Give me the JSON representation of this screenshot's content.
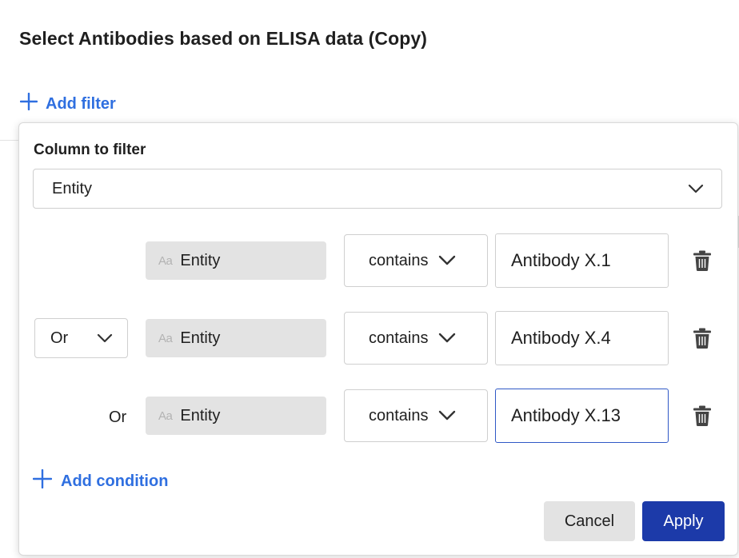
{
  "page": {
    "title": "Select Antibodies based on ELISA data (Copy)"
  },
  "toolbar": {
    "add_filter_label": "Add filter"
  },
  "filter_popover": {
    "column_label": "Column to filter",
    "column_value": "Entity",
    "conditions": [
      {
        "logic": "",
        "field_icon": "Aa",
        "field": "Entity",
        "operator": "contains",
        "value": "Antibody X.1"
      },
      {
        "logic": "Or",
        "field_icon": "Aa",
        "field": "Entity",
        "operator": "contains",
        "value": "Antibody X.4"
      },
      {
        "logic": "Or",
        "field_icon": "Aa",
        "field": "Entity",
        "operator": "contains",
        "value": "Antibody X.13"
      }
    ],
    "add_condition_label": "Add condition",
    "cancel_label": "Cancel",
    "apply_label": "Apply"
  },
  "colors": {
    "accent": "#2f6fe0",
    "apply_bg": "#1c3aa9",
    "chip_bg": "#e3e3e3",
    "focus_border": "#2f58c6"
  },
  "icons": [
    "plus-icon",
    "chevron-down-icon",
    "trash-icon"
  ]
}
